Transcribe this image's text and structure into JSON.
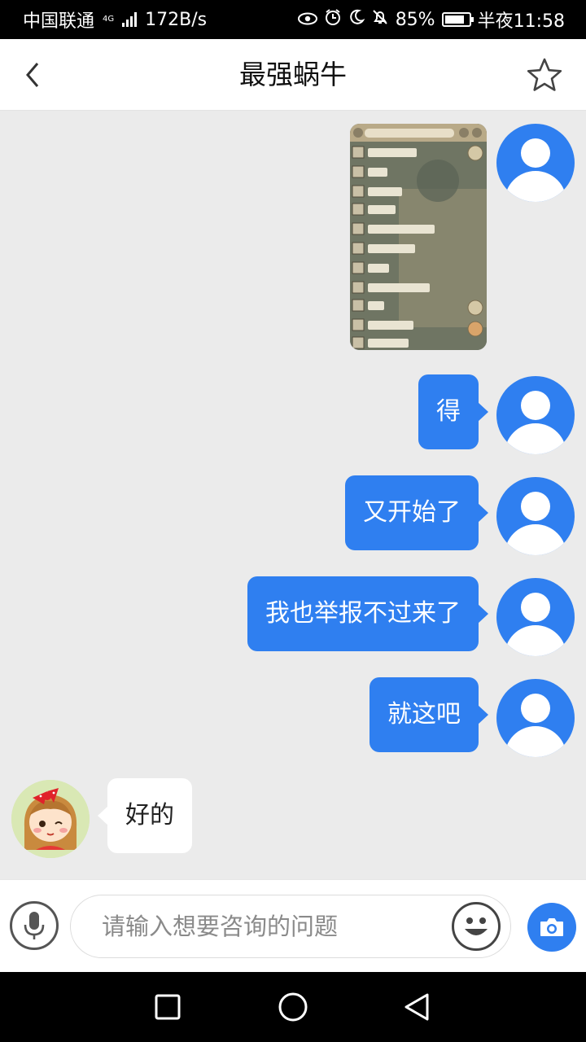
{
  "status_bar": {
    "carrier": "中国联通",
    "network": "4G",
    "speed": "172B/s",
    "battery": "85%",
    "battery_level": 0.85,
    "time": "半夜11:58"
  },
  "header": {
    "title": "最强蜗牛",
    "back_icon": "chevron-left-icon",
    "favorite_icon": "star-outline-icon"
  },
  "messages": [
    {
      "from": "me",
      "type": "image"
    },
    {
      "from": "me",
      "text": "得"
    },
    {
      "from": "me",
      "text": "又开始了"
    },
    {
      "from": "me",
      "text": "我也举报不过来了"
    },
    {
      "from": "me",
      "text": "就这吧"
    },
    {
      "from": "agent",
      "text": "好的"
    }
  ],
  "input": {
    "placeholder": "请输入想要咨询的问题",
    "value": ""
  },
  "colors": {
    "accent": "#2f7ff0",
    "chat_bg": "#ebebeb",
    "bubble_in": "#ffffff"
  }
}
